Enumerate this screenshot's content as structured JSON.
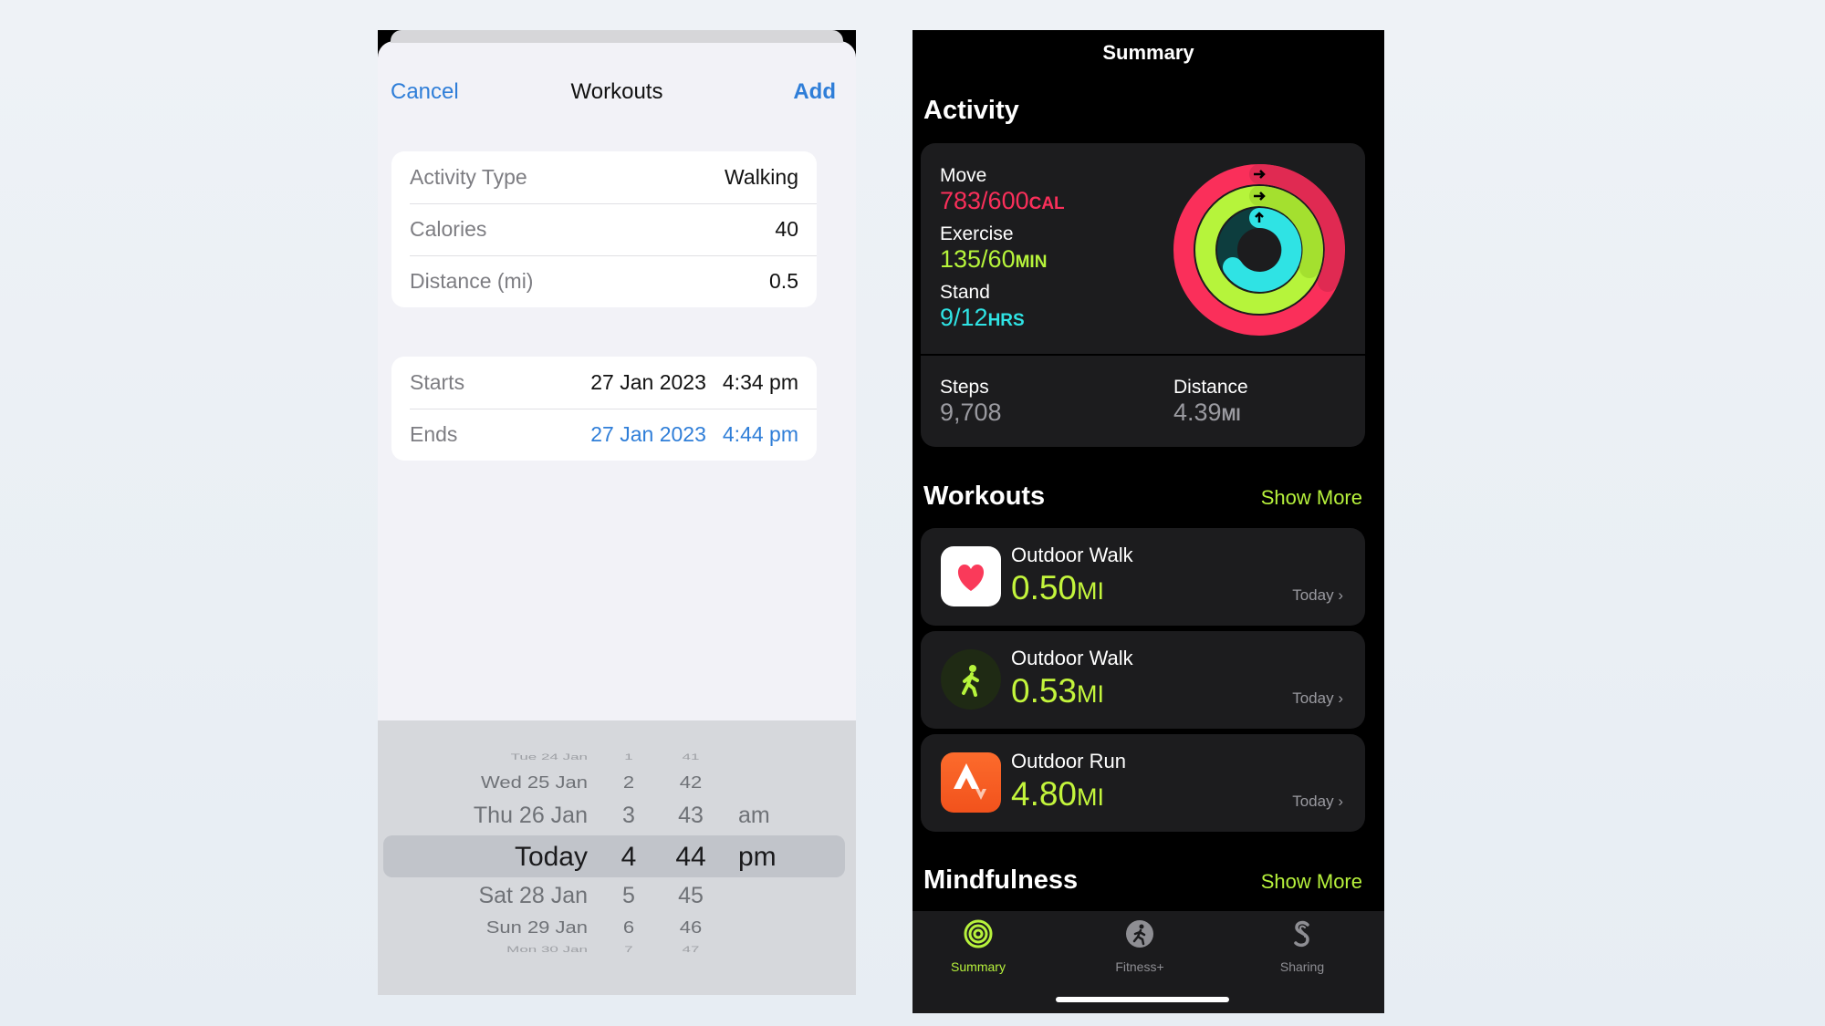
{
  "left": {
    "nav": {
      "cancel": "Cancel",
      "title": "Workouts",
      "add": "Add"
    },
    "details": [
      {
        "label": "Activity Type",
        "value": "Walking"
      },
      {
        "label": "Calories",
        "value": "40"
      },
      {
        "label": "Distance (mi)",
        "value": "0.5"
      }
    ],
    "times": {
      "starts": {
        "label": "Starts",
        "date": "27 Jan 2023",
        "time": "4:34 pm"
      },
      "ends": {
        "label": "Ends",
        "date": "27 Jan 2023",
        "time": "4:44 pm"
      }
    },
    "picker": {
      "dates": [
        "Tue 24 Jan",
        "Wed 25 Jan",
        "Thu 26 Jan",
        "Today",
        "Sat 28 Jan",
        "Sun 29 Jan",
        "Mon 30 Jan"
      ],
      "hours": [
        "1",
        "2",
        "3",
        "4",
        "5",
        "6",
        "7"
      ],
      "minutes": [
        "41",
        "42",
        "43",
        "44",
        "45",
        "46",
        "47"
      ],
      "ampm": [
        "am",
        "pm"
      ]
    }
  },
  "right": {
    "title": "Summary",
    "activity": {
      "heading": "Activity",
      "move": {
        "label": "Move",
        "value": "783/600",
        "unit": "CAL",
        "color": "#fa2f5a"
      },
      "exercise": {
        "label": "Exercise",
        "value": "135/60",
        "unit": "MIN",
        "color": "#b6f43b"
      },
      "stand": {
        "label": "Stand",
        "value": "9/12",
        "unit": "HRS",
        "color": "#2fe3e4"
      },
      "steps": {
        "label": "Steps",
        "value": "9,708"
      },
      "distance": {
        "label": "Distance",
        "value": "4.39",
        "unit": "MI"
      }
    },
    "workouts": {
      "heading": "Workouts",
      "show_more": "Show More",
      "items": [
        {
          "name": "Outdoor Walk",
          "value": "0.50",
          "unit": "MI",
          "date": "Today",
          "icon": "health-heart-icon"
        },
        {
          "name": "Outdoor Walk",
          "value": "0.53",
          "unit": "MI",
          "date": "Today",
          "icon": "walking-figure-icon"
        },
        {
          "name": "Outdoor Run",
          "value": "4.80",
          "unit": "MI",
          "date": "Today",
          "icon": "strava-icon"
        }
      ]
    },
    "mindfulness": {
      "heading": "Mindfulness",
      "show_more": "Show More"
    },
    "tabs": [
      {
        "label": "Summary",
        "icon": "activity-rings-icon",
        "active": true
      },
      {
        "label": "Fitness+",
        "icon": "fitness-plus-icon",
        "active": false
      },
      {
        "label": "Sharing",
        "icon": "sharing-icon",
        "active": false
      }
    ]
  }
}
